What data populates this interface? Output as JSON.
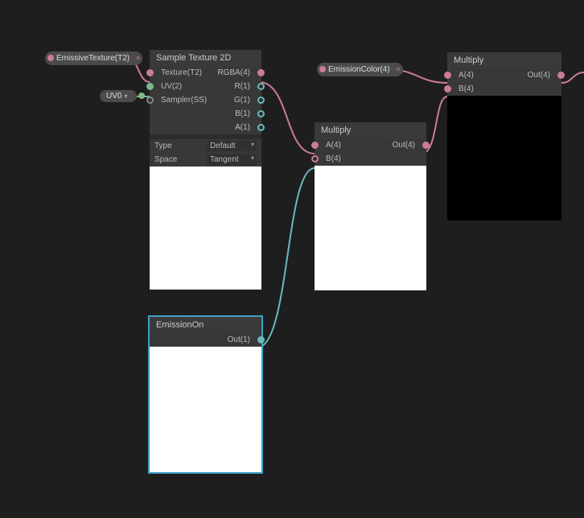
{
  "chips": {
    "emissiveTexture": "EmissiveTexture(T2)",
    "uv0": "UV0",
    "emissionColor": "EmissionColor(4)"
  },
  "nodes": {
    "sampleTexture": {
      "title": "Sample Texture 2D",
      "inputs": {
        "texture": "Texture(T2)",
        "uv": "UV(2)",
        "sampler": "Sampler(SS)"
      },
      "outputs": {
        "rgba": "RGBA(4)",
        "r": "R(1)",
        "g": "G(1)",
        "b": "B(1)",
        "a": "A(1)"
      },
      "props": {
        "typeLabel": "Type",
        "typeValue": "Default",
        "spaceLabel": "Space",
        "spaceValue": "Tangent"
      }
    },
    "emissionOn": {
      "title": "EmissionOn",
      "outputs": {
        "out": "Out(1)"
      }
    },
    "multiply1": {
      "title": "Multiply",
      "inputs": {
        "a": "A(4)",
        "b": "B(4)"
      },
      "outputs": {
        "out": "Out(4)"
      }
    },
    "multiply2": {
      "title": "Multiply",
      "inputs": {
        "a": "A(4)",
        "b": "B(4)"
      },
      "outputs": {
        "out": "Out(4)"
      }
    }
  }
}
